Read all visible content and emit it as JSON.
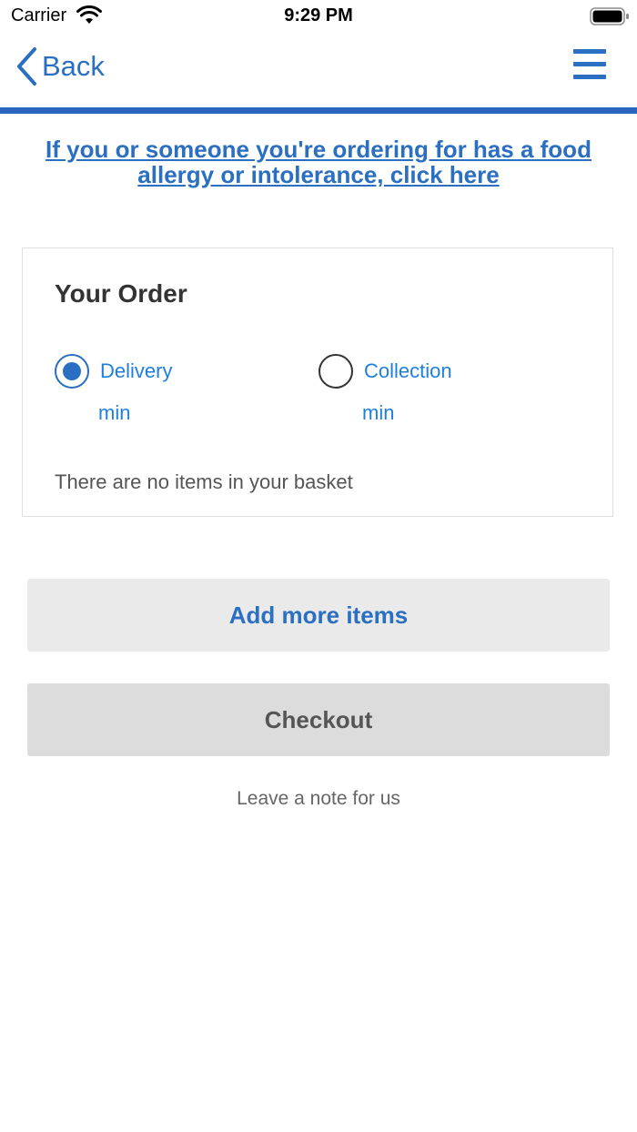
{
  "status_bar": {
    "carrier": "Carrier",
    "time": "9:29 PM",
    "icons": [
      "wifi-icon",
      "battery-icon"
    ]
  },
  "nav": {
    "back_label": "Back",
    "icons": [
      "chevron-left-icon",
      "hamburger-menu-icon"
    ]
  },
  "allergy_notice": "If you or someone you're ordering for has a food allergy or intolerance, click here",
  "order": {
    "title": "Your Order",
    "options": [
      {
        "label": "Delivery",
        "time": "min",
        "selected": true
      },
      {
        "label": "Collection",
        "time": "min",
        "selected": false
      }
    ],
    "empty_message": "There are no items in your basket"
  },
  "actions": {
    "add_more": "Add more items",
    "checkout": "Checkout",
    "leave_note": "Leave a note for us"
  },
  "colors": {
    "accent": "#2a6fc1",
    "link_light": "#1f7fe0",
    "divider": "#2a66bd",
    "button_add_bg": "#eaeaea",
    "button_checkout_bg": "#dcdcdc"
  }
}
